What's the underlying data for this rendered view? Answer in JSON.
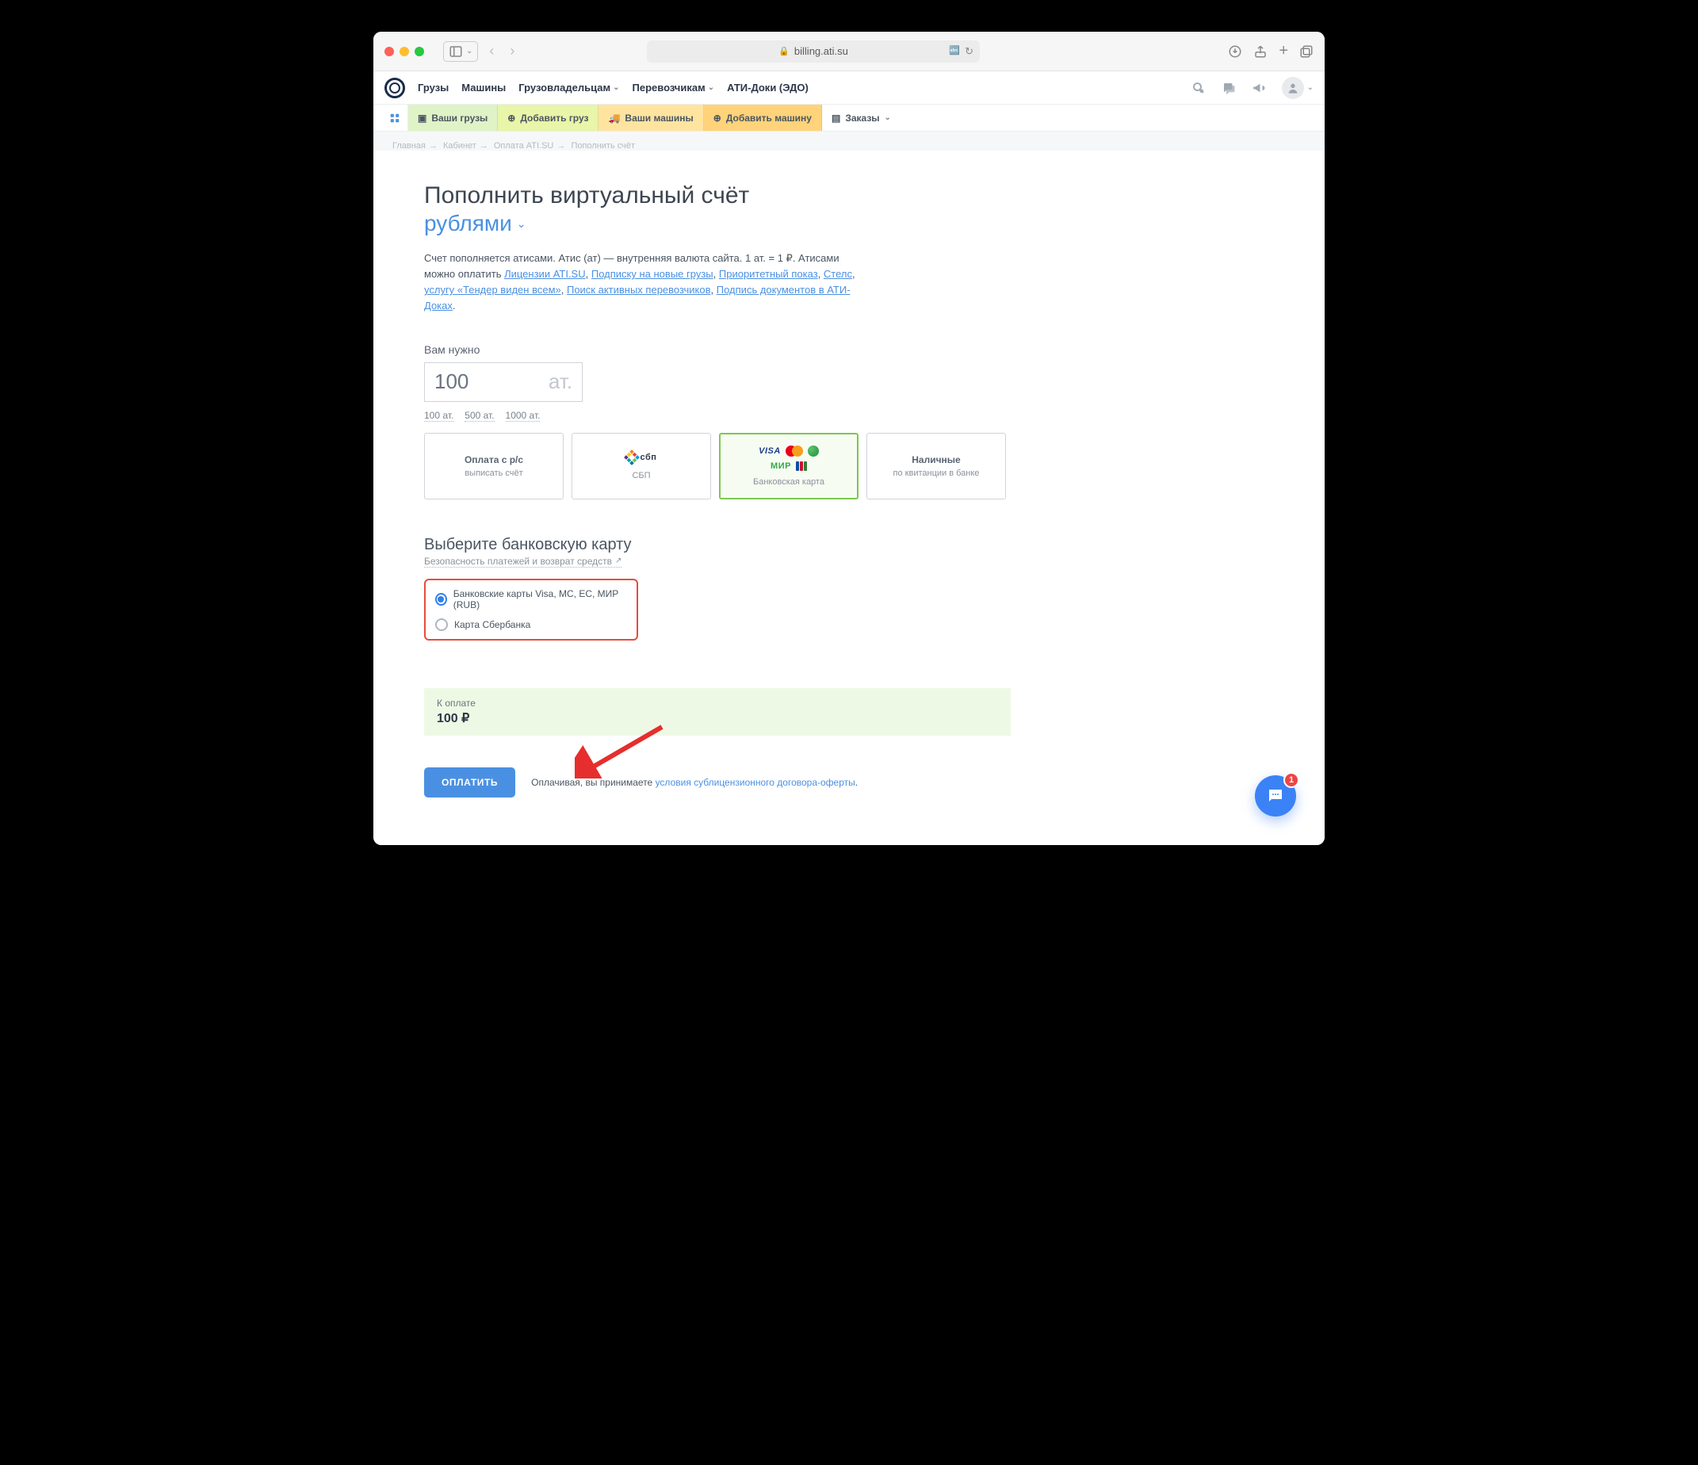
{
  "browser": {
    "url": "billing.ati.su"
  },
  "topnav": {
    "items": [
      "Грузы",
      "Машины",
      "Грузовладельцам",
      "Перевозчикам",
      "АТИ-Доки (ЭДО)"
    ]
  },
  "subbar": {
    "b1": "Ваши грузы",
    "b2": "Добавить груз",
    "b3": "Ваши машины",
    "b4": "Добавить машину",
    "b5": "Заказы"
  },
  "crumbs": {
    "c1": "Главная",
    "c2": "Кабинет",
    "c3": "Оплата ATI.SU",
    "c4": "Пополнить счёт"
  },
  "page": {
    "title": "Пополнить виртуальный счёт",
    "currency": "рублями",
    "desc_pre": "Счет пополняется атисами. Атис (ат) — внутренняя валюта сайта. 1 ат. = 1 ₽. Атисами можно оплатить ",
    "links": {
      "l1": "Лицензии ATI.SU",
      "l2": "Подписку на новые грузы",
      "l3": "Приоритетный показ",
      "l4": "Стелс",
      "l5": "услугу «Тендер виден всем»",
      "l6": "Поиск активных перевозчиков",
      "l7": "Подпись документов в АТИ-Доках"
    },
    "amount_label": "Вам нужно",
    "amount_value": "100",
    "amount_unit": "ат.",
    "presets": {
      "p1": "100 ат.",
      "p2": "500 ат.",
      "p3": "1000 ат."
    },
    "methods": {
      "m1_title": "Оплата с р/с",
      "m1_sub": "выписать счёт",
      "m2_label": "сбп",
      "m2_sub": "СБП",
      "m3_sub": "Банковская карта",
      "m3_mir": "МИР",
      "m3_visa": "VISA",
      "m4_title": "Наличные",
      "m4_sub": "по квитанции в банке"
    },
    "select_card_h": "Выберите банковскую карту",
    "safety_link": "Безопасность платежей и возврат средств",
    "radio1": "Банковские карты Visa, MC, EC, МИР (RUB)",
    "radio2": "Карта Сбербанка",
    "total_label": "К оплате",
    "total_value": "100 ₽",
    "pay_btn": "ОПЛАТИТЬ",
    "pay_note_pre": "Оплачивая, вы принимаете ",
    "pay_note_link": "условия сублицензионного договора-оферты",
    "pay_note_post": "."
  },
  "chat": {
    "badge": "1"
  }
}
